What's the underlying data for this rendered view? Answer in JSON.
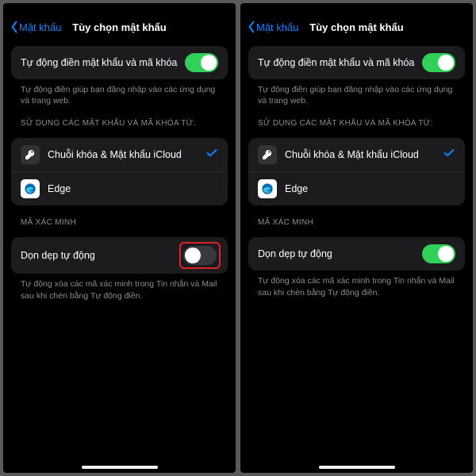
{
  "back_label": "Mật khẩu",
  "title": "Tùy chọn mật khẩu",
  "autofill": {
    "label": "Tự động điền mật khẩu và mã khóa",
    "footer": "Tự động điền giúp bạn đăng nhập vào các ứng dụng và trang web."
  },
  "sources": {
    "header": "SỬ DỤNG CÁC MẬT KHẨU VÀ MÃ KHÓA TỪ:",
    "icloud": "Chuỗi khóa & Mật khẩu iCloud",
    "edge": "Edge"
  },
  "verify": {
    "header": "MÃ XÁC MINH",
    "label": "Dọn dẹp tự động",
    "footer": "Tự động xóa các mã xác minh trong Tin nhắn và Mail sau khi chèn bằng Tự động điền."
  }
}
